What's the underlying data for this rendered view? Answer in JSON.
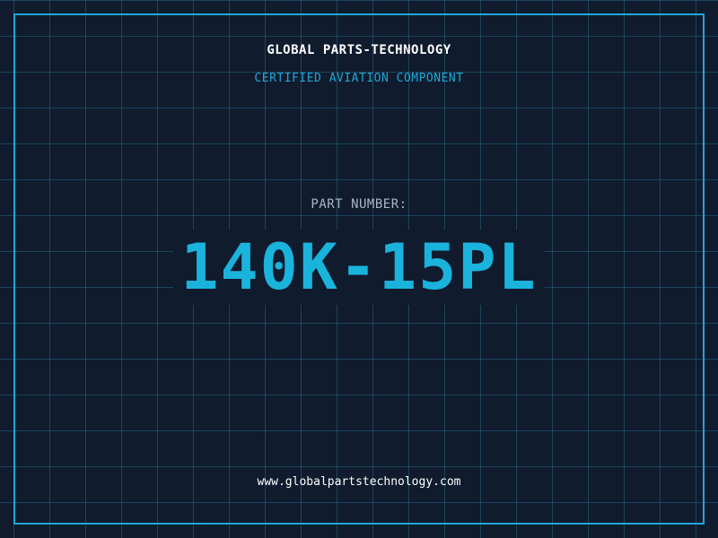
{
  "header": {
    "company": "GLOBAL PARTS-TECHNOLOGY",
    "subtitle": "CERTIFIED AVIATION COMPONENT"
  },
  "part": {
    "label": "PART NUMBER:",
    "number": "140K-15PL"
  },
  "footer": {
    "website": "www.globalpartstechnology.com"
  },
  "colors": {
    "background": "#101b2e",
    "grid": "#266680",
    "accent": "#1ea7d6",
    "part_number": "#1ab3dc",
    "label": "#a9b7c8",
    "text": "#ffffff"
  }
}
